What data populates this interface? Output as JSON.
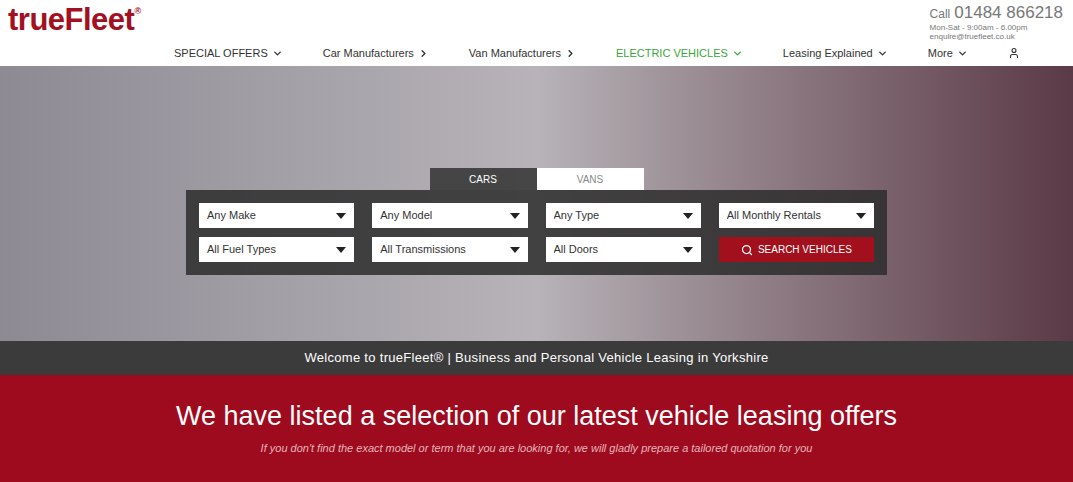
{
  "logo": {
    "name": "trueFleet",
    "mark": "®"
  },
  "contact": {
    "call_label": "Call",
    "phone": "01484 866218",
    "hours": "Mon-Sat - 9:00am - 6.00pm",
    "email": "enquire@truefleet.co.uk"
  },
  "nav": [
    {
      "label": "SPECIAL OFFERS",
      "kind": "dropdown",
      "highlighted": false
    },
    {
      "label": "Car Manufacturers",
      "kind": "submenu",
      "highlighted": false
    },
    {
      "label": "Van Manufacturers",
      "kind": "submenu",
      "highlighted": false
    },
    {
      "label": "ELECTRIC VEHICLES",
      "kind": "dropdown",
      "highlighted": true
    },
    {
      "label": "Leasing Explained",
      "kind": "dropdown",
      "highlighted": false
    },
    {
      "label": "More",
      "kind": "dropdown",
      "highlighted": false
    }
  ],
  "search": {
    "tabs": [
      {
        "label": "CARS",
        "selected": true
      },
      {
        "label": "VANS",
        "selected": false
      }
    ],
    "filters": [
      "Any Make",
      "Any Model",
      "Any Type",
      "All Monthly Rentals",
      "All Fuel Types",
      "All Transmissions",
      "All Doors"
    ],
    "button": "SEARCH VEHICLES"
  },
  "welcome": "Welcome to trueFleet® | Business and Personal Vehicle Leasing in Yorkshire",
  "offers": {
    "heading": "We have listed a selection of our latest vehicle leasing offers",
    "subtitle": "If you don't find the exact model or term that you are looking for, we will gladly prepare a tailored quotation for you"
  }
}
